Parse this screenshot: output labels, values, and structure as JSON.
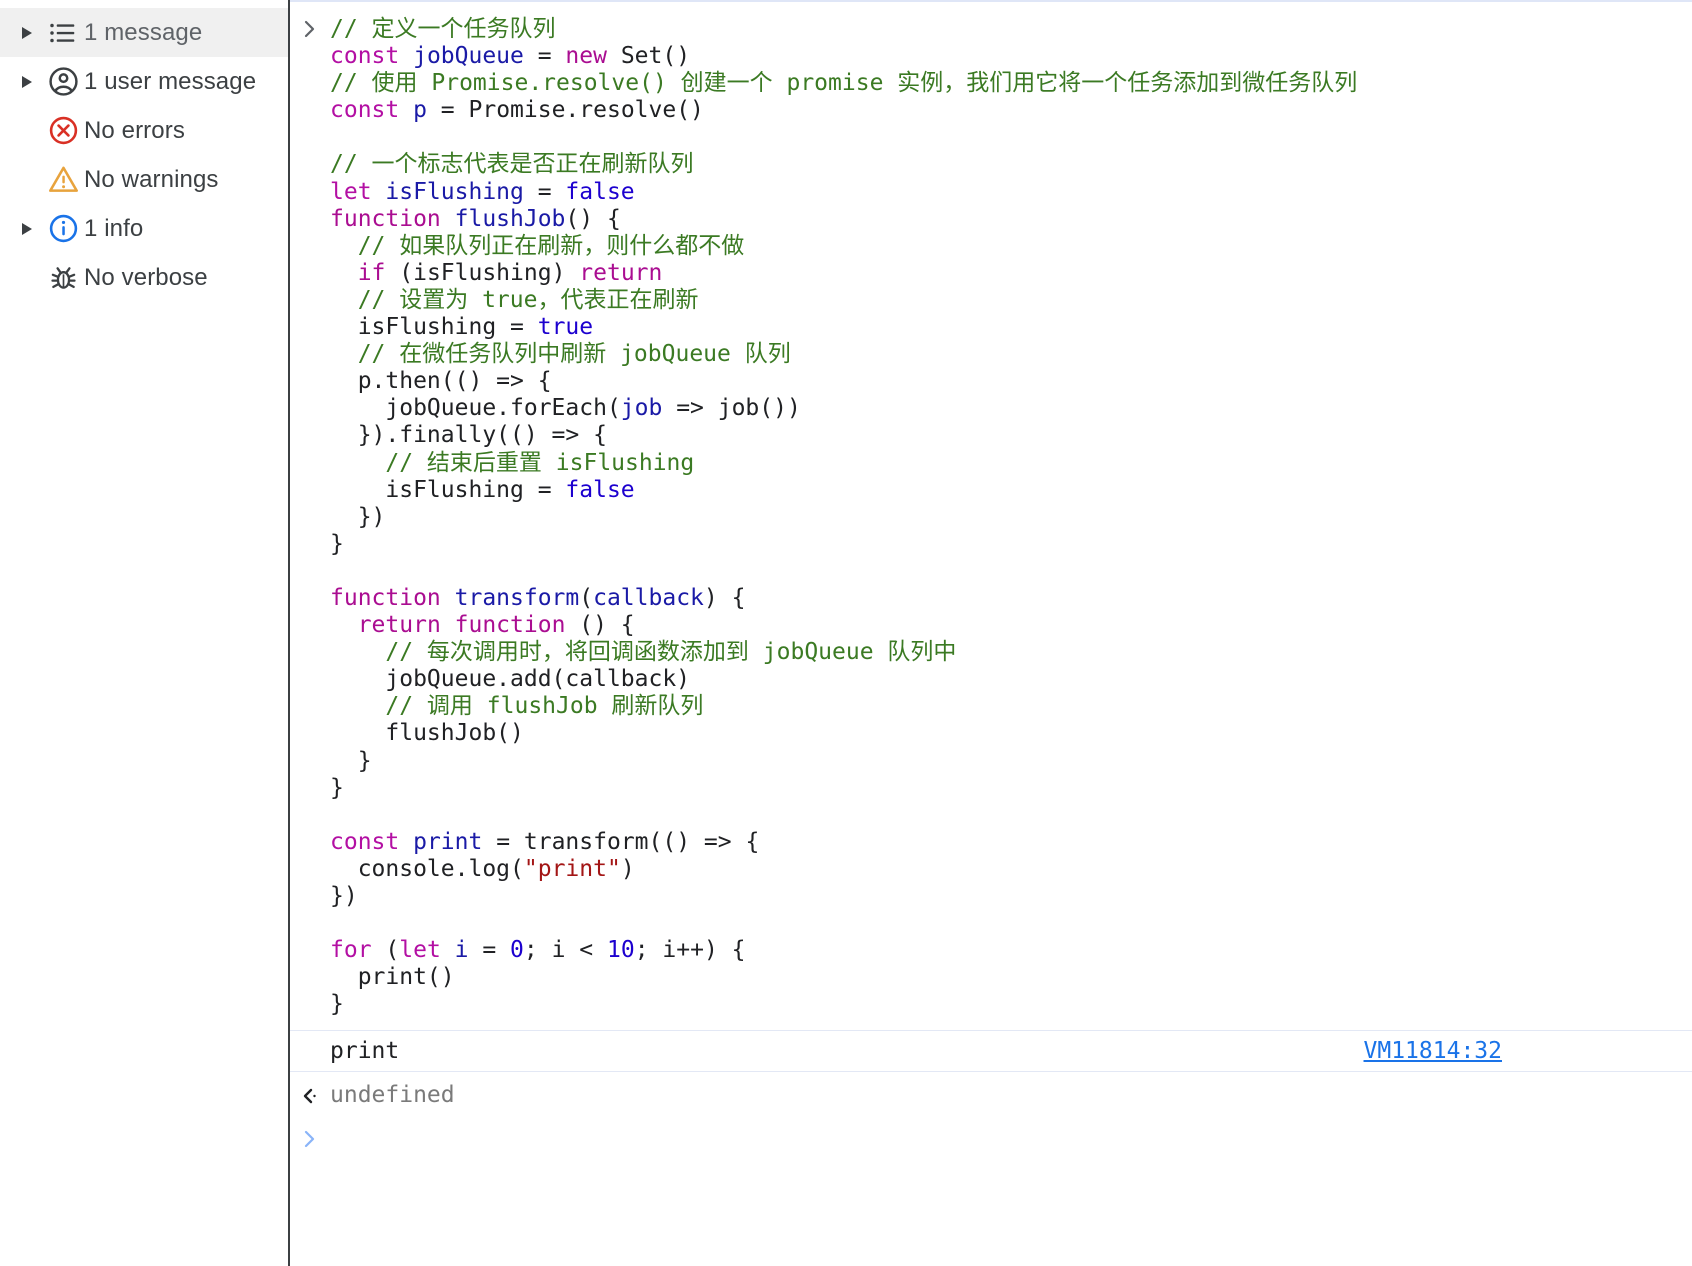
{
  "sidebar": {
    "items": [
      {
        "label": "1 message",
        "icon": "list-icon",
        "twisty": true,
        "selected": true
      },
      {
        "label": "1 user message",
        "icon": "user-icon",
        "twisty": true,
        "selected": false
      },
      {
        "label": "No errors",
        "icon": "error-icon",
        "twisty": false,
        "selected": false
      },
      {
        "label": "No warnings",
        "icon": "warning-icon",
        "twisty": false,
        "selected": false
      },
      {
        "label": "1 info",
        "icon": "info-icon",
        "twisty": true,
        "selected": false
      },
      {
        "label": "No verbose",
        "icon": "bug-icon",
        "twisty": false,
        "selected": false
      }
    ]
  },
  "console": {
    "input_prompt_glyph": "›",
    "code_lines": [
      {
        "tokens": [
          {
            "t": "// 定义一个任务队列",
            "c": "cm"
          }
        ]
      },
      {
        "tokens": [
          {
            "t": "const ",
            "c": "kw2"
          },
          {
            "t": "jobQueue",
            "c": "id"
          },
          {
            "t": " = ",
            "c": "pl"
          },
          {
            "t": "new ",
            "c": "kw"
          },
          {
            "t": "Set()",
            "c": "pl"
          }
        ]
      },
      {
        "tokens": [
          {
            "t": "// 使用 Promise.resolve() 创建一个 promise 实例，我们用它将一个任务添加到微任务队列",
            "c": "cm"
          }
        ]
      },
      {
        "tokens": [
          {
            "t": "const ",
            "c": "kw2"
          },
          {
            "t": "p",
            "c": "id"
          },
          {
            "t": " = Promise.resolve()",
            "c": "pl"
          }
        ]
      },
      {
        "tokens": [
          {
            "t": "",
            "c": "pl"
          }
        ]
      },
      {
        "tokens": [
          {
            "t": "// 一个标志代表是否正在刷新队列",
            "c": "cm"
          }
        ]
      },
      {
        "tokens": [
          {
            "t": "let ",
            "c": "kw2"
          },
          {
            "t": "isFlushing",
            "c": "id"
          },
          {
            "t": " = ",
            "c": "pl"
          },
          {
            "t": "false",
            "c": "bl"
          }
        ]
      },
      {
        "tokens": [
          {
            "t": "function ",
            "c": "kw"
          },
          {
            "t": "flushJob",
            "c": "id"
          },
          {
            "t": "() {",
            "c": "pl"
          }
        ]
      },
      {
        "tokens": [
          {
            "t": "  // 如果队列正在刷新，则什么都不做",
            "c": "cm"
          }
        ]
      },
      {
        "tokens": [
          {
            "t": "  ",
            "c": "pl"
          },
          {
            "t": "if",
            "c": "kw"
          },
          {
            "t": " (isFlushing) ",
            "c": "pl"
          },
          {
            "t": "return",
            "c": "kw"
          }
        ]
      },
      {
        "tokens": [
          {
            "t": "  // 设置为 true，代表正在刷新",
            "c": "cm"
          }
        ]
      },
      {
        "tokens": [
          {
            "t": "  isFlushing = ",
            "c": "pl"
          },
          {
            "t": "true",
            "c": "bl"
          }
        ]
      },
      {
        "tokens": [
          {
            "t": "  // 在微任务队列中刷新 jobQueue 队列",
            "c": "cm"
          }
        ]
      },
      {
        "tokens": [
          {
            "t": "  p.then(() => {",
            "c": "pl"
          }
        ]
      },
      {
        "tokens": [
          {
            "t": "    jobQueue.forEach(",
            "c": "pl"
          },
          {
            "t": "job",
            "c": "id"
          },
          {
            "t": " => job())",
            "c": "pl"
          }
        ]
      },
      {
        "tokens": [
          {
            "t": "  }).finally(() => {",
            "c": "pl"
          }
        ]
      },
      {
        "tokens": [
          {
            "t": "    // 结束后重置 isFlushing",
            "c": "cm"
          }
        ]
      },
      {
        "tokens": [
          {
            "t": "    isFlushing = ",
            "c": "pl"
          },
          {
            "t": "false",
            "c": "bl"
          }
        ]
      },
      {
        "tokens": [
          {
            "t": "  })",
            "c": "pl"
          }
        ]
      },
      {
        "tokens": [
          {
            "t": "}",
            "c": "pl"
          }
        ]
      },
      {
        "tokens": [
          {
            "t": "",
            "c": "pl"
          }
        ]
      },
      {
        "tokens": [
          {
            "t": "function ",
            "c": "kw"
          },
          {
            "t": "transform",
            "c": "id"
          },
          {
            "t": "(",
            "c": "pl"
          },
          {
            "t": "callback",
            "c": "id"
          },
          {
            "t": ") {",
            "c": "pl"
          }
        ]
      },
      {
        "tokens": [
          {
            "t": "  ",
            "c": "pl"
          },
          {
            "t": "return ",
            "c": "kw"
          },
          {
            "t": "function",
            "c": "kw"
          },
          {
            "t": " () {",
            "c": "pl"
          }
        ]
      },
      {
        "tokens": [
          {
            "t": "    // 每次调用时，将回调函数添加到 jobQueue 队列中",
            "c": "cm"
          }
        ]
      },
      {
        "tokens": [
          {
            "t": "    jobQueue.add(callback)",
            "c": "pl"
          }
        ]
      },
      {
        "tokens": [
          {
            "t": "    // 调用 flushJob 刷新队列",
            "c": "cm"
          }
        ]
      },
      {
        "tokens": [
          {
            "t": "    flushJob()",
            "c": "pl"
          }
        ]
      },
      {
        "tokens": [
          {
            "t": "  }",
            "c": "pl"
          }
        ]
      },
      {
        "tokens": [
          {
            "t": "}",
            "c": "pl"
          }
        ]
      },
      {
        "tokens": [
          {
            "t": "",
            "c": "pl"
          }
        ]
      },
      {
        "tokens": [
          {
            "t": "const ",
            "c": "kw2"
          },
          {
            "t": "print",
            "c": "id"
          },
          {
            "t": " = transform(() => {",
            "c": "pl"
          }
        ]
      },
      {
        "tokens": [
          {
            "t": "  console.log(",
            "c": "pl"
          },
          {
            "t": "\"print\"",
            "c": "st"
          },
          {
            "t": ")",
            "c": "pl"
          }
        ]
      },
      {
        "tokens": [
          {
            "t": "})",
            "c": "pl"
          }
        ]
      },
      {
        "tokens": [
          {
            "t": "",
            "c": "pl"
          }
        ]
      },
      {
        "tokens": [
          {
            "t": "for ",
            "c": "kw2"
          },
          {
            "t": "(",
            "c": "pl"
          },
          {
            "t": "let ",
            "c": "kw2"
          },
          {
            "t": "i",
            "c": "id"
          },
          {
            "t": " = ",
            "c": "pl"
          },
          {
            "t": "0",
            "c": "nm"
          },
          {
            "t": "; i < ",
            "c": "pl"
          },
          {
            "t": "10",
            "c": "nm"
          },
          {
            "t": "; i++) {",
            "c": "pl"
          }
        ]
      },
      {
        "tokens": [
          {
            "t": "  print()",
            "c": "pl"
          }
        ]
      },
      {
        "tokens": [
          {
            "t": "}",
            "c": "pl"
          }
        ]
      }
    ],
    "log_message": {
      "text": "print",
      "source_link": "VM11814:32"
    },
    "result": {
      "return_glyph": "‹·",
      "value": "undefined"
    },
    "prompt": {
      "glyph": "›",
      "value": "",
      "placeholder": ""
    }
  },
  "colors": {
    "comment": "#3b7a23",
    "keyword": "#aa0d91",
    "identifier": "#1a1aa6",
    "number": "#1c00cf",
    "string": "#a31515",
    "link": "#1a73e8",
    "error": "#d93025",
    "warning": "#e8a33d",
    "info": "#1a73e8",
    "text": "#202124",
    "selected_row": "#f0f0f0"
  }
}
